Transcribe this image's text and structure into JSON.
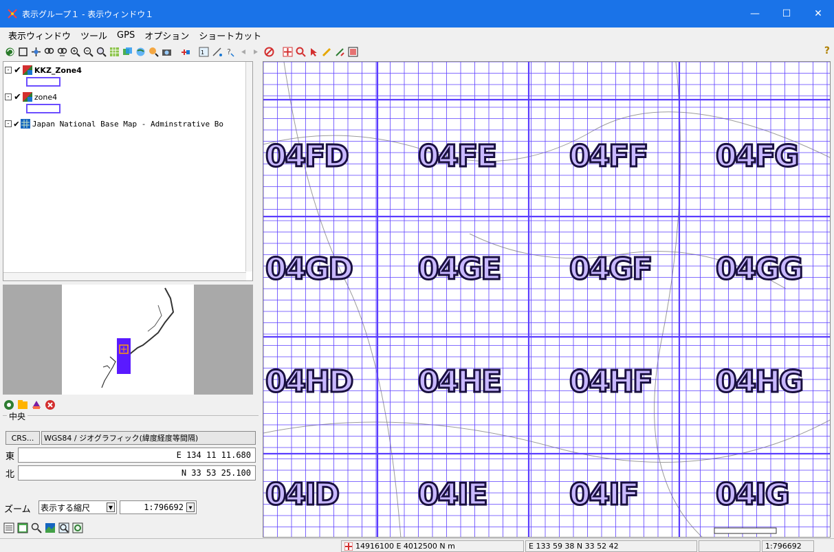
{
  "window": {
    "title": "表示グループ１ - 表示ウィンドウ１"
  },
  "menu": {
    "items": [
      "表示ウィンドウ",
      "ツール",
      "GPS",
      "オプション",
      "ショートカット"
    ]
  },
  "toolbar": {
    "help": "?"
  },
  "layers": [
    {
      "name": "KKZ_Zone4",
      "bold": true
    },
    {
      "name": "zone4",
      "bold": false
    },
    {
      "name": "Japan National Base Map - Adminstrative Bo",
      "bold": false
    }
  ],
  "center": {
    "legend": "中央",
    "crs_button": "CRS...",
    "crs_value": "WGS84 / ジオグラフィック(緯度経度等間隔)",
    "east_label": "東",
    "east_value": "E 134 11 11.680",
    "north_label": "北",
    "north_value": "N 33 53 25.100"
  },
  "zoom": {
    "label": "ズーム",
    "mode": "表示する縮尺",
    "scale": "1:796692"
  },
  "map": {
    "tiles": [
      [
        "04FD",
        "04FE",
        "04FF",
        "04FG"
      ],
      [
        "04GD",
        "04GE",
        "04GF",
        "04GG"
      ],
      [
        "04HD",
        "04HE",
        "04HF",
        "04HG"
      ],
      [
        "04ID",
        "04IE",
        "04IF",
        "04IG"
      ]
    ],
    "scale_bar": "1:796692"
  },
  "status": {
    "projected": "14916100 E   4012500 N m",
    "geographic": "E 133 59 38   N 33 52 42",
    "scale": "1:796692"
  },
  "colors": {
    "titlebar": "#1a73e8",
    "grid": "#5a3cff",
    "label_fill": "#c8b8ff"
  }
}
